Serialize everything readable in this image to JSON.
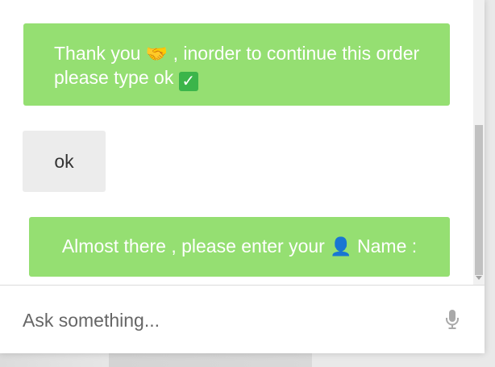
{
  "messages": [
    {
      "sender": "bot",
      "text_before": "Thank you ",
      "emoji": "🤝",
      "text_after": " , inorder to continue this order please type ok ",
      "badge_icon": "check-mark-button-icon"
    },
    {
      "sender": "user",
      "text": "ok"
    },
    {
      "sender": "bot",
      "text_before": "Almost there , please enter your ",
      "icon": "person-silhouette-icon",
      "text_after": " Name :"
    }
  ],
  "input": {
    "placeholder": "Ask something...",
    "value": ""
  },
  "icons": {
    "mic": "microphone-icon"
  },
  "colors": {
    "bot_bubble": "#95df72",
    "user_bubble": "#ececec",
    "bot_text": "#ffffff",
    "user_text": "#333333"
  }
}
